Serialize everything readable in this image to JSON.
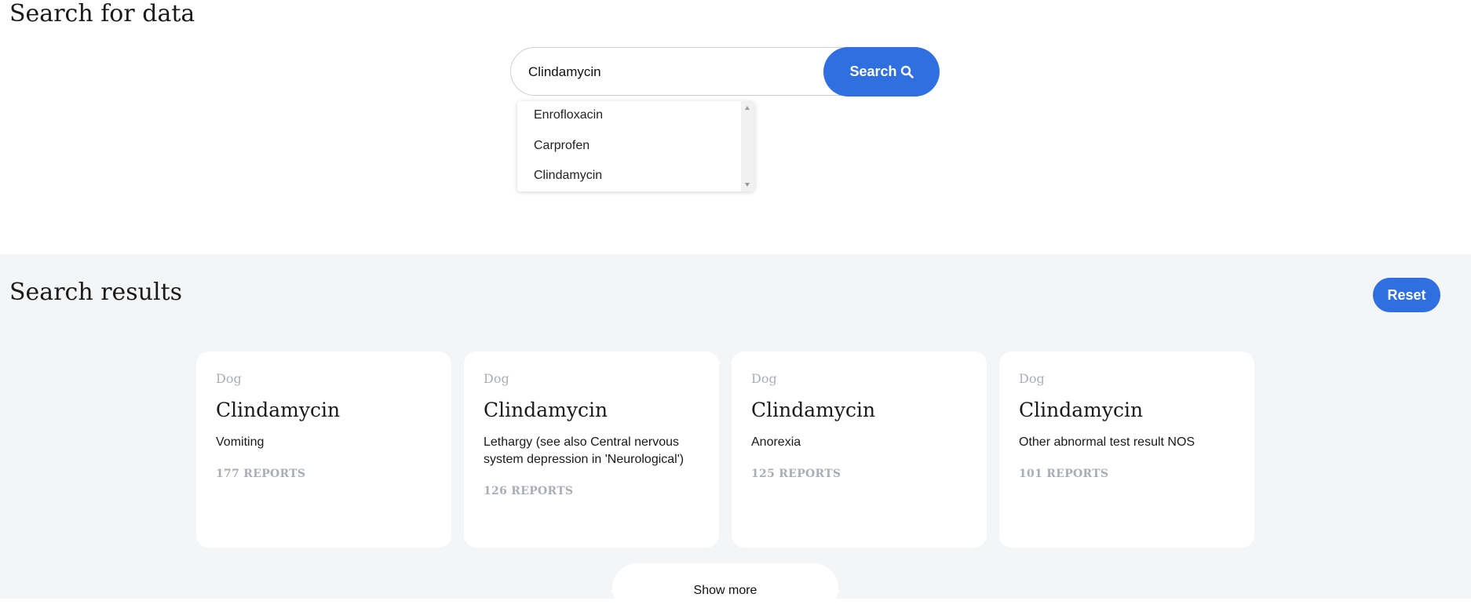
{
  "header": {
    "title": "Search for data"
  },
  "search": {
    "value": "Clindamycin",
    "button_label": "Search",
    "suggestions": [
      "Enrofloxacin",
      "Carprofen",
      "Clindamycin"
    ]
  },
  "results": {
    "title": "Search results",
    "reset_label": "Reset",
    "cards": [
      {
        "species": "Dog",
        "drug": "Clindamycin",
        "reaction": "Vomiting",
        "reports": "177 REPORTS"
      },
      {
        "species": "Dog",
        "drug": "Clindamycin",
        "reaction": "Lethargy (see also Central nervous system depression in 'Neurological')",
        "reports": "126 REPORTS"
      },
      {
        "species": "Dog",
        "drug": "Clindamycin",
        "reaction": "Anorexia",
        "reports": "125 REPORTS"
      },
      {
        "species": "Dog",
        "drug": "Clindamycin",
        "reaction": "Other abnormal test result NOS",
        "reports": "101 REPORTS"
      }
    ],
    "show_more_label": "Show more"
  },
  "colors": {
    "accent": "#2f6fdf",
    "results_bg": "#f4f5f7",
    "muted": "#a9aeb5"
  },
  "icons": {
    "search_button": "search-icon"
  }
}
